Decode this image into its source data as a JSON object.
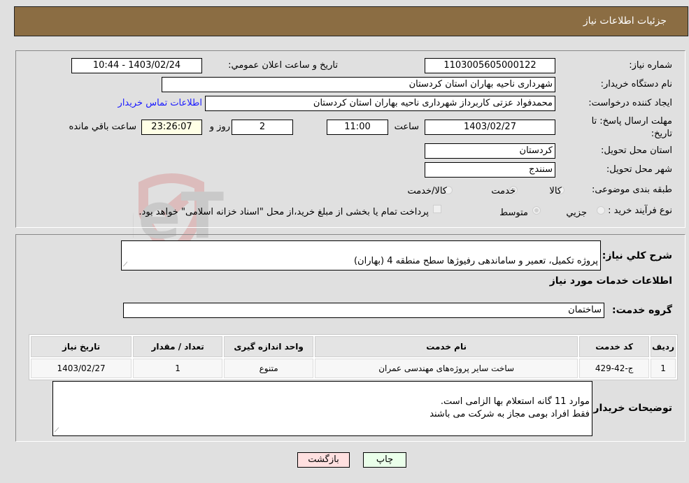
{
  "header": {
    "title": "جزئیات اطلاعات نیاز"
  },
  "form": {
    "need_number_label": "شماره نیاز:",
    "need_number": "1103005605000122",
    "announce_label": "تاریخ و ساعت اعلان عمومي:",
    "announce_value": "1403/02/24 - 10:44",
    "buyer_org_label": "نام دستگاه خریدار:",
    "buyer_org": "شهرداری ناحیه بهاران استان کردستان",
    "creator_label": "ایجاد کننده درخواست:",
    "creator": "محمدفواد عزتی کاربرداز شهرداری ناحیه بهاران استان کردستان",
    "contact_link": "اطلاعات تماس خریدار",
    "deadline_label": "مهلت ارسال پاسخ: تا تاریخ:",
    "deadline_date": "1403/02/27",
    "time_label": "ساعت",
    "deadline_time": "11:00",
    "days_value": "2",
    "days_label": "روز و",
    "remaining_time": "23:26:07",
    "remaining_label": "ساعت باقي مانده",
    "province_label": "استان محل تحویل:",
    "province": "کردستان",
    "city_label": "شهر محل تحویل:",
    "city": "سنندج",
    "category_label": "طبقه بندی موضوعی:",
    "category_options": [
      "کالا",
      "خدمت",
      "کالا/خدمت"
    ],
    "category_selected": "خدمت",
    "process_label": "نوع فرآیند خرید :",
    "process_options": [
      "جزيي",
      "متوسط"
    ],
    "process_selected": "متوسط",
    "treasury_note": "پرداخت تمام یا بخشی از مبلغ خرید،از محل \"اسناد خزانه اسلامی\" خواهد بود."
  },
  "details": {
    "description_label": "شرح كلي نياز:",
    "description": "پروژه تکمیل، تعمیر و ساماندهی رفیوژها سطح منطقه 4 (بهاران)",
    "services_heading": "اطلاعات خدمات مورد نیاز",
    "service_group_label": "گروه خدمت:",
    "service_group": "ساختمان",
    "table": {
      "headers": [
        "ردیف",
        "کد خدمت",
        "نام خدمت",
        "واحد اندازه گیری",
        "تعداد / مقدار",
        "تاریخ نیاز"
      ],
      "rows": [
        [
          "1",
          "ج-42-429",
          "ساخت سایر پروژه‌های مهندسی عمران",
          "متنوع",
          "1",
          "1403/02/27"
        ]
      ]
    },
    "buyer_notes_label": "توضیحات خریدار:",
    "buyer_notes": "موارد 11 گانه استعلام بها الزامی است.\nفقط افراد بومی مجاز به شرکت می باشند"
  },
  "buttons": {
    "print": "چاپ",
    "back": "بازگشت"
  },
  "colors": {
    "header_bg": "#8b6d43",
    "print_bg": "#eaffea",
    "back_bg": "#ffe0e0",
    "link": "#1a1aff"
  }
}
